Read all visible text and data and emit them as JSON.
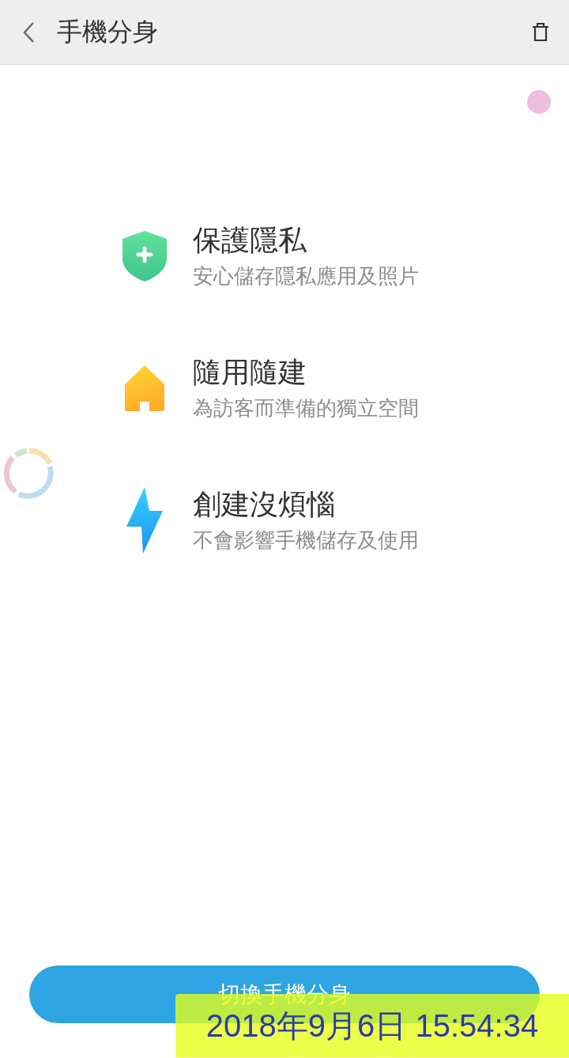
{
  "header": {
    "title": "手機分身"
  },
  "features": [
    {
      "kind": "shield",
      "title": "保護隱私",
      "subtitle": "安心儲存隱私應用及照片"
    },
    {
      "kind": "house",
      "title": "隨用隨建",
      "subtitle": "為訪客而準備的獨立空間"
    },
    {
      "kind": "bolt",
      "title": "創建沒煩惱",
      "subtitle": "不會影響手機儲存及使用"
    }
  ],
  "primary_button": {
    "label": "切換手機分身"
  },
  "timestamp_overlay": {
    "text": "2018年9月6日 15:54:34"
  }
}
